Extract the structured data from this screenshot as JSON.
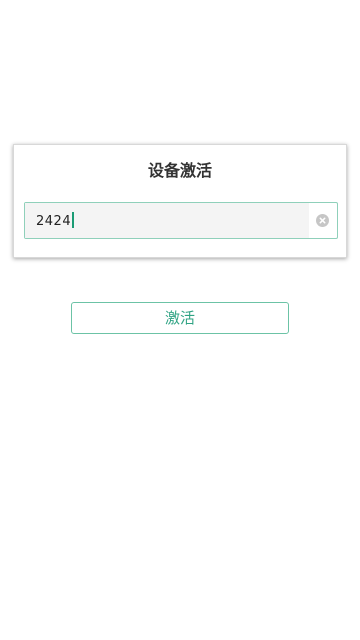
{
  "dialog": {
    "title": "设备激活",
    "input": {
      "value": "2424",
      "clear_icon": "clear-circle-icon"
    }
  },
  "activate_button": {
    "label": "激活"
  },
  "colors": {
    "accent": "#2fa383",
    "input_border": "#8fd0ba",
    "caret": "#1a9b74"
  }
}
